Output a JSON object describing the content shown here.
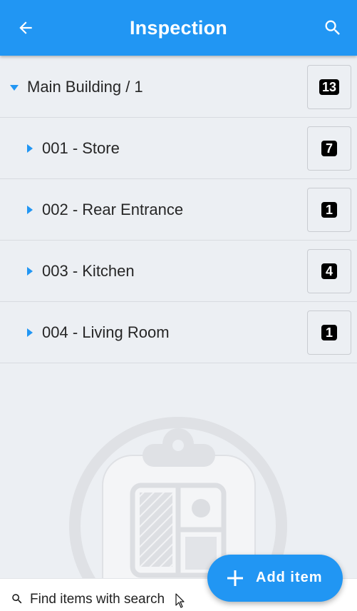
{
  "header": {
    "title": "Inspection",
    "back_icon": "arrow-left-icon",
    "search_icon": "search-icon",
    "background": "#2196f3"
  },
  "tree": {
    "root": {
      "label": "Main Building / 1",
      "count": "13",
      "expanded": true
    },
    "children": [
      {
        "label": "001 - Store",
        "count": "7",
        "expanded": false
      },
      {
        "label": "002 - Rear Entrance",
        "count": "1",
        "expanded": false
      },
      {
        "label": "003 - Kitchen",
        "count": "4",
        "expanded": false
      },
      {
        "label": "004 - Living Room",
        "count": "1",
        "expanded": false
      }
    ]
  },
  "empty_state": {
    "icon": "clipboard-floorplan-icon"
  },
  "bottom_bar": {
    "hint": "Find items with search",
    "icon": "search-icon"
  },
  "fab": {
    "label": "Add item",
    "icon": "plus-icon"
  },
  "colors": {
    "accent": "#2196f3",
    "background": "#eceff3",
    "badge": "#000000"
  }
}
